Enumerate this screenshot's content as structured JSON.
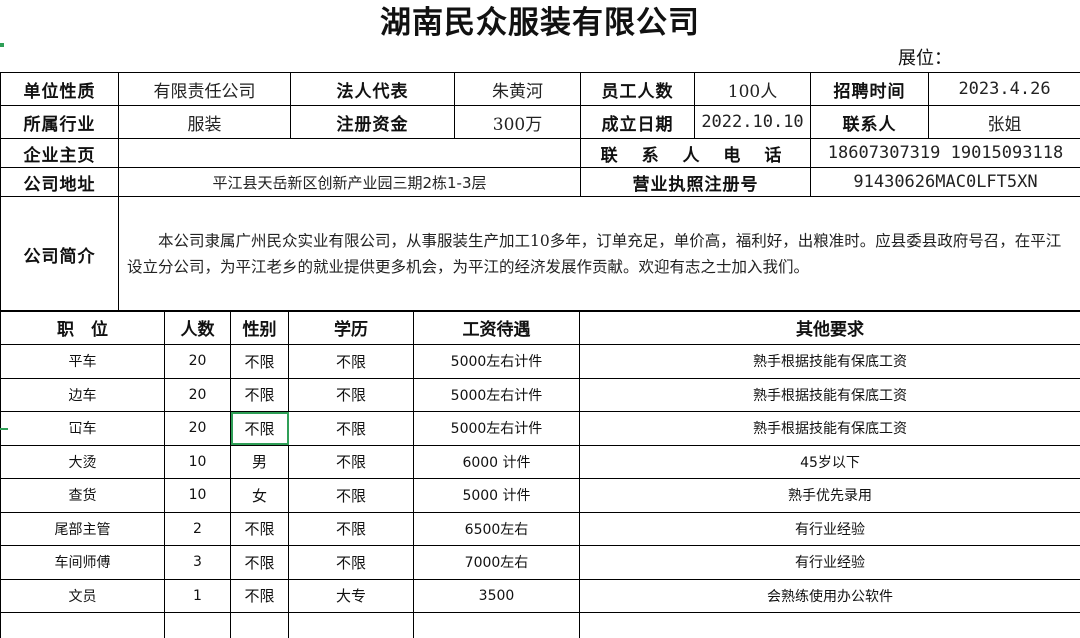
{
  "header": {
    "company_title": "湖南民众服装有限公司",
    "booth_label": "展位："
  },
  "info": {
    "nature_label": "单位性质",
    "nature_value": "有限责任公司",
    "legal_rep_label": "法人代表",
    "legal_rep_value": "朱黄河",
    "staff_label": "员工人数",
    "staff_value": "100人",
    "recruit_time_label": "招聘时间",
    "recruit_time_value": "2023.4.26",
    "industry_label": "所属行业",
    "industry_value": "服装",
    "capital_label": "注册资金",
    "capital_value": "300万",
    "founded_label": "成立日期",
    "founded_value": "2022.10.10",
    "contact_label": "联系人",
    "contact_value": "张姐",
    "homepage_label": "企业主页",
    "homepage_value": "",
    "phone_label": "联 系 人 电 话",
    "phone_value": "18607307319  19015093118",
    "address_label": "公司地址",
    "address_value": "平江县天岳新区创新产业园三期2栋1-3层",
    "license_label": "营业执照注册号",
    "license_value": "91430626MAC0LFT5XN",
    "intro_label": "公司简介",
    "intro_text": "本公司隶属广州民众实业有限公司，从事服装生产加工10多年，订单充足，单价高，福利好，出粮准时。应县委县政府号召，在平江设立分公司，为平江老乡的就业提供更多机会，为平江的经济发展作贡献。欢迎有志之士加入我们。"
  },
  "jobs": {
    "headers": {
      "position": "职　位",
      "count": "人数",
      "gender": "性别",
      "education": "学历",
      "salary": "工资待遇",
      "other": "其他要求"
    },
    "rows": [
      {
        "position": "平车",
        "count": "20",
        "gender": "不限",
        "education": "不限",
        "salary": "5000左右计件",
        "other": "熟手根据技能有保底工资"
      },
      {
        "position": "边车",
        "count": "20",
        "gender": "不限",
        "education": "不限",
        "salary": "5000左右计件",
        "other": "熟手根据技能有保底工资"
      },
      {
        "position": "冚车",
        "count": "20",
        "gender": "不限",
        "education": "不限",
        "salary": "5000左右计件",
        "other": "熟手根据技能有保底工资"
      },
      {
        "position": "大烫",
        "count": "10",
        "gender": "男",
        "education": "不限",
        "salary": "6000 计件",
        "other": "45岁以下"
      },
      {
        "position": "查货",
        "count": "10",
        "gender": "女",
        "education": "不限",
        "salary": "5000 计件",
        "other": "熟手优先录用"
      },
      {
        "position": "尾部主管",
        "count": "2",
        "gender": "不限",
        "education": "不限",
        "salary": "6500左右",
        "other": "有行业经验"
      },
      {
        "position": "车间师傅",
        "count": "3",
        "gender": "不限",
        "education": "不限",
        "salary": "7000左右",
        "other": "有行业经验"
      },
      {
        "position": "文员",
        "count": "1",
        "gender": "不限",
        "education": "大专",
        "salary": "3500",
        "other": "会熟练使用办公软件"
      },
      {
        "position": "",
        "count": "",
        "gender": "",
        "education": "",
        "salary": "",
        "other": ""
      }
    ]
  }
}
